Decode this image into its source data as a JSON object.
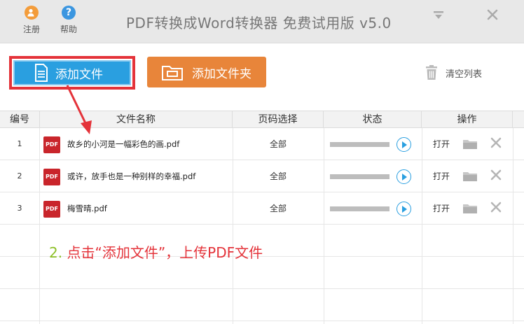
{
  "titlebar": {
    "register_label": "注册",
    "help_label": "帮助",
    "help_glyph": "?",
    "title": "PDF转换成Word转换器 免费试用版 v5.0"
  },
  "toolbar": {
    "add_file_label": "添加文件",
    "add_folder_label": "添加文件夹",
    "clear_list_label": "清空列表"
  },
  "table": {
    "headers": [
      "编号",
      "文件名称",
      "页码选择",
      "状态",
      "操作"
    ],
    "rows": [
      {
        "no": "1",
        "icon_text": "PDF",
        "name": "故乡的小河是一幅彩色的画.pdf",
        "pages": "全部",
        "progress": 0,
        "action": "打开"
      },
      {
        "no": "2",
        "icon_text": "PDF",
        "name": "或许，放手也是一种别样的幸福.pdf",
        "pages": "全部",
        "progress": 0,
        "action": "打开"
      },
      {
        "no": "3",
        "icon_text": "PDF",
        "name": "梅雪晴.pdf",
        "pages": "全部",
        "progress": 0,
        "action": "打开"
      }
    ]
  },
  "annotation": {
    "number": "2.",
    "text": "点击“添加文件”，上传PDF文件"
  },
  "colors": {
    "accent_blue": "#2a9fe0",
    "accent_orange": "#e8853a",
    "highlight_red": "#e4333a",
    "step_green": "#8cbf26"
  }
}
